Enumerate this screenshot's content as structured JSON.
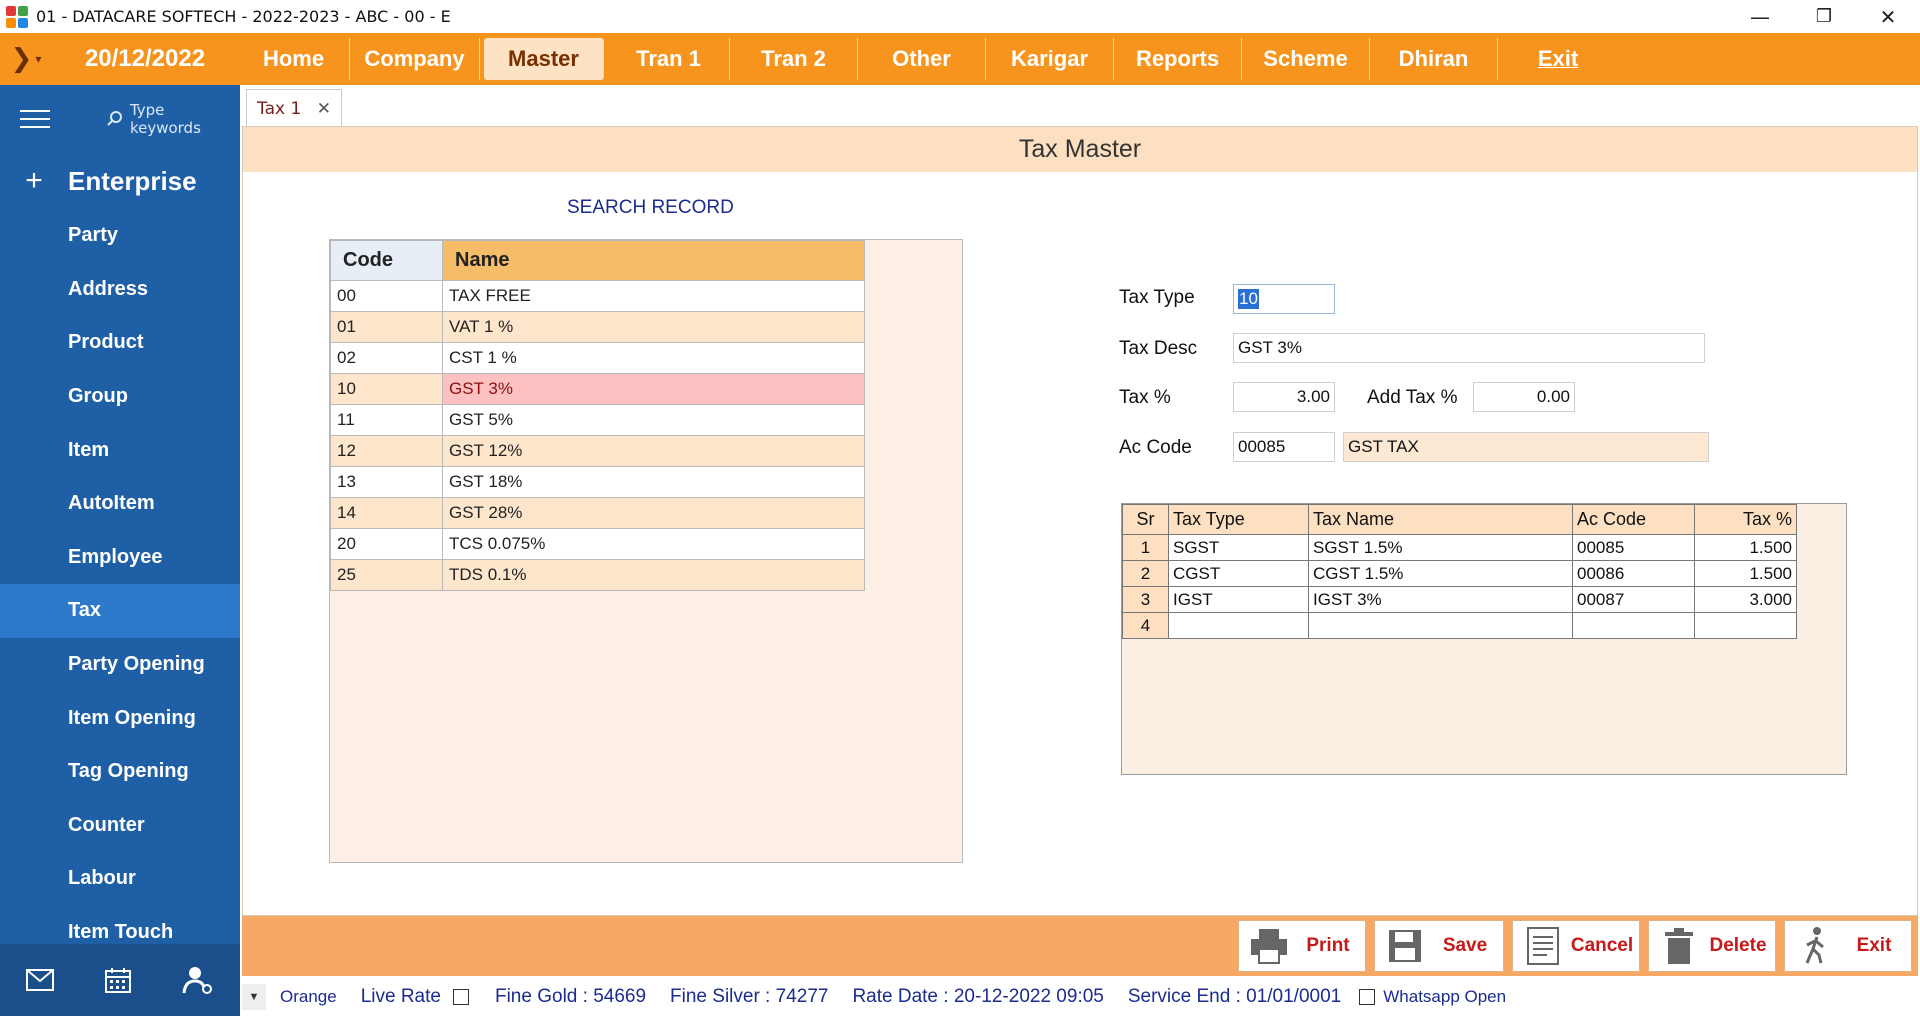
{
  "window": {
    "title": "01 - DATACARE SOFTECH - 2022-2023 - ABC - 00 - E"
  },
  "menubar": {
    "date": "20/12/2022",
    "items": [
      "Home",
      "Company",
      "Master",
      "Tran 1",
      "Tran 2",
      "Other",
      "Karigar",
      "Reports",
      "Scheme",
      "Dhiran",
      "Exit"
    ],
    "active": "Master"
  },
  "sidebar": {
    "search_placeholder": "Type keywords",
    "section": "Enterprise",
    "items": [
      "Party",
      "Address",
      "Product",
      "Group",
      "Item",
      "AutoItem",
      "Employee",
      "Tax",
      "Party Opening",
      "Item Opening",
      "Tag Opening",
      "Counter",
      "Labour",
      "Item Touch"
    ],
    "active": "Tax"
  },
  "tab": {
    "label": "Tax 1"
  },
  "form": {
    "title": "Tax Master",
    "search_title": "SEARCH RECORD",
    "grid": {
      "headers": [
        "Code",
        "Name"
      ],
      "rows": [
        [
          "00",
          "TAX FREE"
        ],
        [
          "01",
          "VAT 1 %"
        ],
        [
          "02",
          "CST 1 %"
        ],
        [
          "10",
          "GST 3%"
        ],
        [
          "11",
          "GST 5%"
        ],
        [
          "12",
          "GST 12%"
        ],
        [
          "13",
          "GST 18%"
        ],
        [
          "14",
          "GST 28%"
        ],
        [
          "20",
          "TCS 0.075%"
        ],
        [
          "25",
          "TDS 0.1%"
        ]
      ],
      "selected_code": "10"
    },
    "fields": {
      "tax_type_label": "Tax Type",
      "tax_type_value": "10",
      "tax_desc_label": "Tax Desc",
      "tax_desc_value": "GST 3%",
      "tax_pct_label": "Tax %",
      "tax_pct_value": "3.00",
      "add_tax_label": "Add Tax %",
      "add_tax_value": "0.00",
      "ac_code_label": "Ac Code",
      "ac_code_value": "00085",
      "ac_name_value": "GST TAX"
    },
    "taxgrid": {
      "headers": [
        "Sr",
        "Tax Type",
        "Tax Name",
        "Ac Code",
        "Tax %"
      ],
      "rows": [
        [
          "1",
          "SGST",
          "SGST 1.5%",
          "00085",
          "1.500"
        ],
        [
          "2",
          "CGST",
          "CGST 1.5%",
          "00086",
          "1.500"
        ],
        [
          "3",
          "IGST",
          "IGST 3%",
          "00087",
          "3.000"
        ],
        [
          "4",
          "",
          "",
          "",
          ""
        ]
      ]
    }
  },
  "actions": {
    "print": "Print",
    "save": "Save",
    "cancel": "Cancel",
    "delete": "Delete",
    "exit": "Exit"
  },
  "statusbar": {
    "theme": "Orange",
    "live_rate": "Live Rate",
    "fine_gold": "Fine Gold : 54669",
    "fine_silver": "Fine Silver : 74277",
    "rate_date": "Rate Date : 20-12-2022 09:05",
    "service_end": "Service End :  01/01/0001",
    "whatsapp": "Whatsapp Open"
  },
  "colors": {
    "menubar": "#f7941d",
    "sidebar": "#1f5fa6",
    "sidebar_active": "#2d78c9",
    "header": "#fde0c2",
    "action_bar": "#f7a865",
    "selected_row": "#fdc1c1"
  }
}
